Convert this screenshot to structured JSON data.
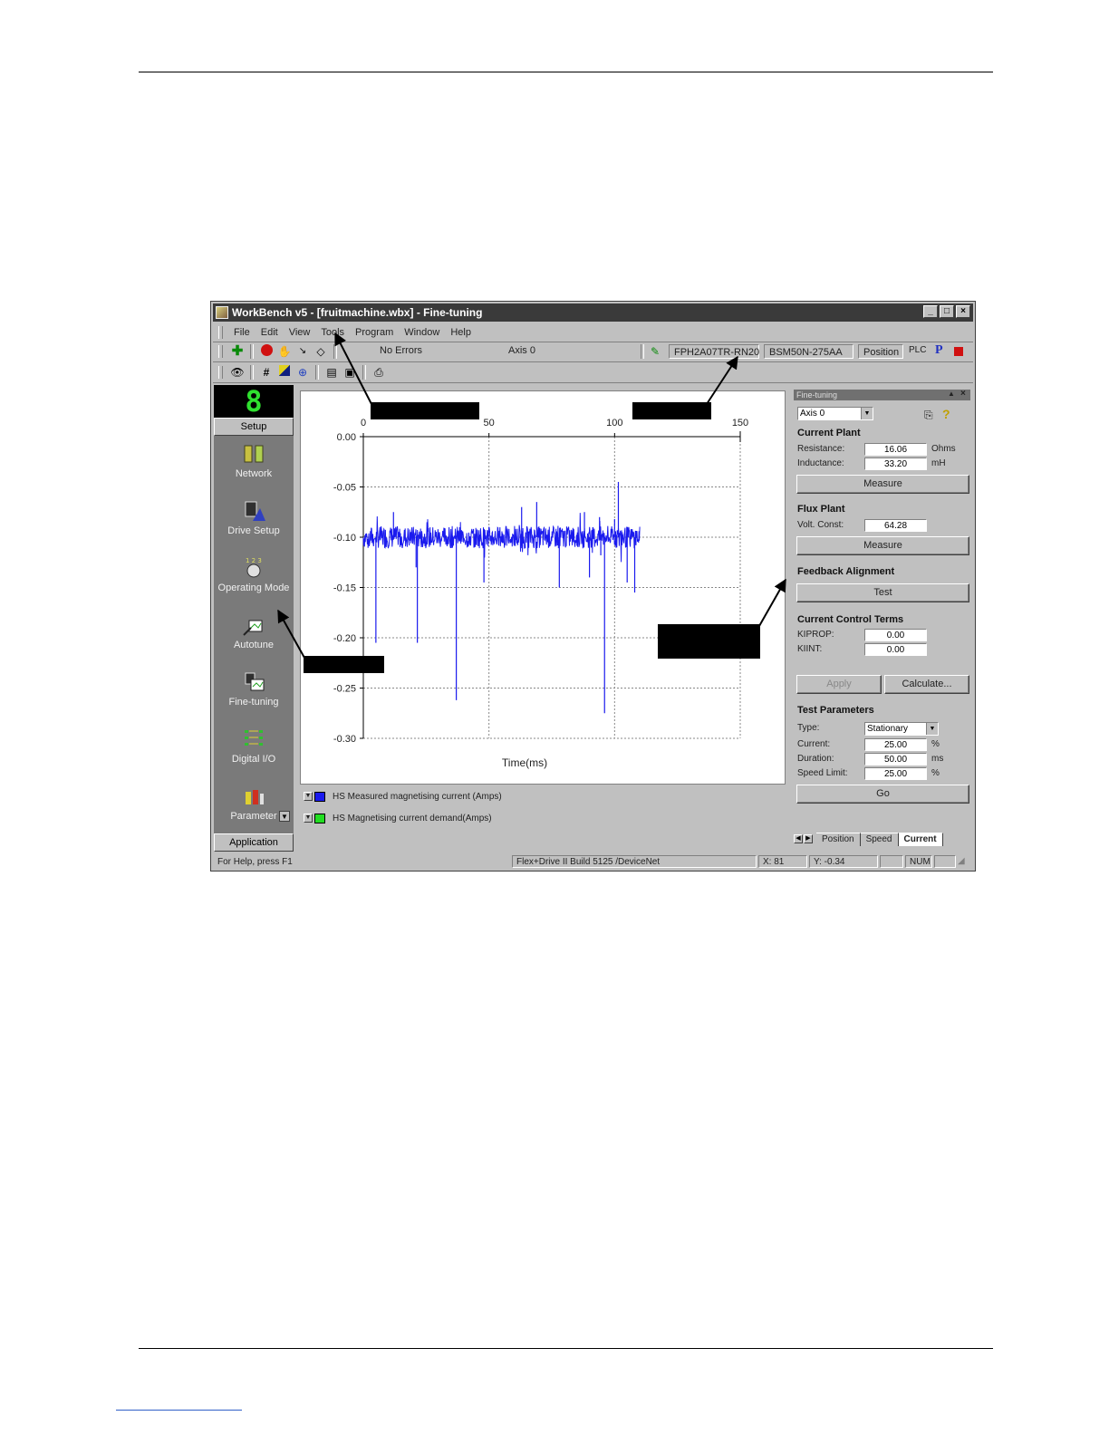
{
  "window": {
    "title": "WorkBench v5 - [fruitmachine.wbx] - Fine-tuning",
    "controls": [
      "minimize-icon",
      "maximize-icon",
      "close-icon"
    ]
  },
  "menu": [
    "File",
    "Edit",
    "View",
    "Tools",
    "Program",
    "Window",
    "Help"
  ],
  "toolbar": {
    "status_text": "No Errors",
    "axis_text": "Axis 0",
    "drive_model": "FPH2A07TR-RN20",
    "motor_model": "BSM50N-275AA",
    "mode": "Position",
    "plc_label": "PLC",
    "p_label": "P"
  },
  "sidebar": {
    "seg_display": "8",
    "setup_label": "Setup",
    "items": [
      {
        "label": "Network",
        "icon": "network-icon"
      },
      {
        "label": "Drive Setup",
        "icon": "drive-setup-icon"
      },
      {
        "label": "Operating Mode",
        "icon": "operating-mode-icon"
      },
      {
        "label": "Autotune",
        "icon": "autotune-icon"
      },
      {
        "label": "Fine-tuning",
        "icon": "fine-tuning-icon"
      },
      {
        "label": "Digital I/O",
        "icon": "digital-io-icon"
      },
      {
        "label": "Parameter",
        "icon": "parameter-icon"
      }
    ],
    "application_label": "Application"
  },
  "chart_data": {
    "type": "line",
    "xlabel": "Time(ms)",
    "ylabel": "",
    "xlim": [
      0,
      150
    ],
    "ylim": [
      -0.3,
      0.0
    ],
    "x_ticks": [
      "0",
      "50",
      "100",
      "150"
    ],
    "y_ticks": [
      "0.00",
      "-0.05",
      "-0.10",
      "-0.15",
      "-0.20",
      "-0.25",
      "-0.30"
    ],
    "grid": true,
    "series": [
      {
        "name": "HS Measured magnetising current (Amps)",
        "color": "#1a1aee",
        "baseline": -0.1,
        "x_range": [
          0,
          110
        ],
        "spikes": [
          {
            "x": 5,
            "y": -0.205
          },
          {
            "x": 12,
            "y": -0.075
          },
          {
            "x": 21,
            "y": -0.13
          },
          {
            "x": 21.5,
            "y": -0.205
          },
          {
            "x": 37,
            "y": -0.262
          },
          {
            "x": 48,
            "y": -0.145
          },
          {
            "x": 63,
            "y": -0.07
          },
          {
            "x": 69,
            "y": -0.065
          },
          {
            "x": 78,
            "y": -0.15
          },
          {
            "x": 88,
            "y": -0.075
          },
          {
            "x": 90,
            "y": -0.14
          },
          {
            "x": 96,
            "y": -0.275
          },
          {
            "x": 94,
            "y": -0.08
          },
          {
            "x": 94.5,
            "y": -0.118
          },
          {
            "x": 100,
            "y": -0.082
          },
          {
            "x": 101.5,
            "y": -0.045
          },
          {
            "x": 103,
            "y": -0.095
          },
          {
            "x": 105,
            "y": -0.145
          },
          {
            "x": 108,
            "y": -0.155
          },
          {
            "x": 108.5,
            "y": -0.108
          }
        ]
      }
    ]
  },
  "legend": [
    {
      "label": "HS Measured magnetising current (Amps)",
      "color": "#1a1aee"
    },
    {
      "label": "HS Magnetising current demand(Amps)",
      "color": "#22dd22"
    }
  ],
  "panel": {
    "title": "Fine-tuning",
    "axis_select": "Axis 0",
    "current_plant": {
      "heading": "Current Plant",
      "resistance_label": "Resistance:",
      "resistance_value": "16.06",
      "resistance_unit": "Ohms",
      "inductance_label": "Inductance:",
      "inductance_value": "33.20",
      "inductance_unit": "mH",
      "measure_label": "Measure"
    },
    "flux_plant": {
      "heading": "Flux Plant",
      "volt_label": "Volt. Const:",
      "volt_value": "64.28",
      "measure_label": "Measure"
    },
    "feedback": {
      "heading": "Feedback Alignment",
      "test_label": "Test"
    },
    "control_terms": {
      "heading": "Current Control Terms",
      "kiprop_label": "KIPROP:",
      "kiprop_value": "0.00",
      "kiint_label": "KIINT:",
      "kiint_value": "0.00"
    },
    "apply_label": "Apply",
    "calculate_label": "Calculate...",
    "test_params": {
      "heading": "Test Parameters",
      "type_label": "Type:",
      "type_value": "Stationary",
      "current_label": "Current:",
      "current_value": "25.00",
      "current_unit": "%",
      "duration_label": "Duration:",
      "duration_value": "50.00",
      "duration_unit": "ms",
      "speed_label": "Speed Limit:",
      "speed_value": "25.00",
      "speed_unit": "%",
      "go_label": "Go"
    },
    "tabs": [
      "Position",
      "Speed",
      "Current"
    ]
  },
  "status": {
    "help": "For Help, press F1",
    "build": "Flex+Drive II Build 5125 /DeviceNet",
    "x": "X: 81",
    "y": "Y: -0.34",
    "num": "NUM"
  }
}
